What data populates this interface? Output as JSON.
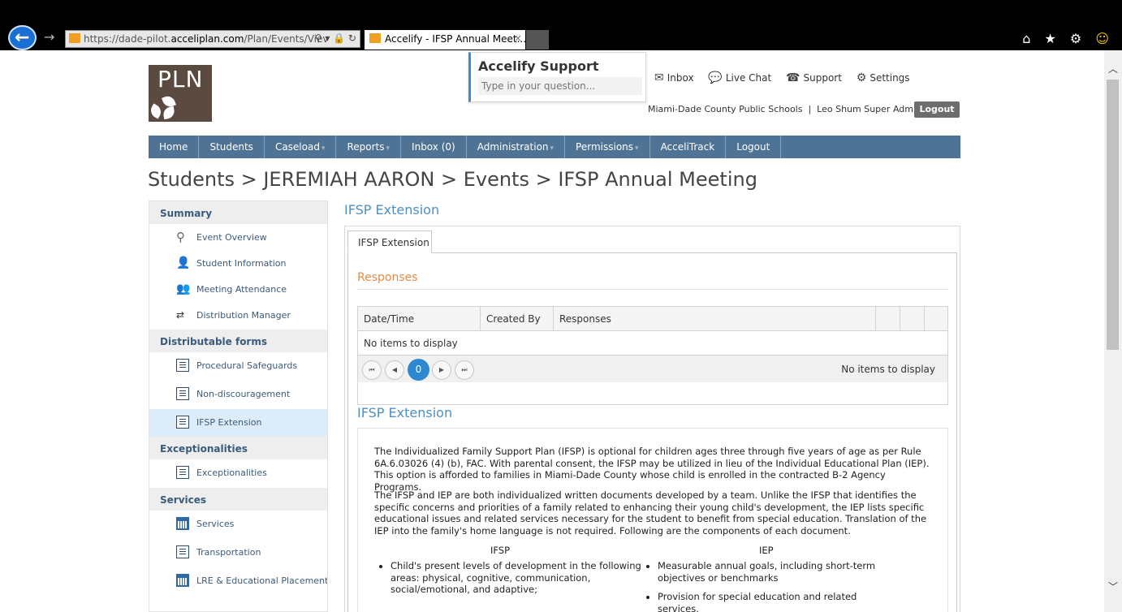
{
  "browser": {
    "url_prefix": "https://dade-pilot.",
    "url_domain": "acceliplan.com",
    "url_rest": "/Plan/Events/Viev",
    "addr_icons": "⚲ ▾ 🔒 ↻",
    "tab_title": "Accelify - IFSP Annual Meet...",
    "tab_close": "×",
    "right_icons": "⌂ ★ ⚙",
    "smile": "☺"
  },
  "logo": {
    "text": "PLN"
  },
  "support": {
    "title": "Accelify Support",
    "placeholder": "Type in your question..."
  },
  "toplinks": {
    "inbox": "Inbox",
    "inbox_icon": "✉",
    "chat": "Live Chat",
    "chat_icon": "💬",
    "support": "Support",
    "support_icon": "☎",
    "settings": "Settings",
    "settings_icon": "⚙"
  },
  "user": {
    "line": "Miami-Dade County Public Schools  |  Leo Shum Super Admin Plus",
    "logout": "Logout"
  },
  "nav": {
    "home": "Home",
    "students": "Students",
    "caseload": "Caseload",
    "reports": "Reports",
    "inbox": "Inbox (0)",
    "administration": "Administration",
    "permissions": "Permissions",
    "accelitrack": "AcceliTrack",
    "logout": "Logout",
    "caret": "▾"
  },
  "breadcrumb": "Students > JEREMIAH AARON > Events > IFSP Annual Meeting",
  "sidebar": {
    "summary": "Summary",
    "event_overview": "Event Overview",
    "student_information": "Student Information",
    "meeting_attendance": "Meeting Attendance",
    "distribution_manager": "Distribution Manager",
    "distributable_forms": "Distributable forms",
    "procedural_safeguards": "Procedural Safeguards",
    "non_discouragement": "Non-discouragement",
    "ifsp_extension": "IFSP Extension",
    "exceptionalities_head": "Exceptionalities",
    "exceptionalities": "Exceptionalities",
    "services_head": "Services",
    "services": "Services",
    "transportation": "Transportation",
    "lre": "LRE & Educational Placement",
    "icons": {
      "search": "⚲",
      "person": "👤",
      "people": "👥",
      "dist": "⇄"
    }
  },
  "content": {
    "title": "IFSP Extension",
    "tab": "IFSP Extension",
    "responses_heading": "Responses",
    "grid": {
      "columns": [
        "Date/Time",
        "Created By",
        "Responses"
      ],
      "empty": "No items to display",
      "pager_current": "0",
      "pager_info": "No items to display",
      "pager_first": "⏮",
      "pager_prev": "◀",
      "pager_next": "▶",
      "pager_last": "⏭"
    },
    "section_heading": "IFSP Extension",
    "para1": "The Individualized Family Support Plan (IFSP) is optional for children ages three through five years of age as per Rule 6A.6.03026 (4) (b), FAC. With parental consent, the IFSP may be utilized in lieu of the Individual Educational Plan (IEP). This option is afforded to families in Miami-Dade County whose child is enrolled in the contracted B-2 Agency Programs.",
    "para2": "The IFSP and IEP are both individualized written documents developed by a team. Unlike the IFSP that identifies the specific concerns and priorities of a family related to enhancing their young child's development, the IEP lists specific educational issues and related services necessary for the student to benefit from special education. Translation of the IEP into the family's home language is not required. Following are the components of each document.",
    "col_ifsp": "IFSP",
    "col_iep": "IEP",
    "ifsp_item1": "Child's present levels of development in the following areas: physical, cognitive, communication, social/emotional, and adaptive;",
    "iep_item1": "Measurable annual goals, including short-term objectives or benchmarks",
    "iep_item2": "Provision for special education and related services,"
  }
}
